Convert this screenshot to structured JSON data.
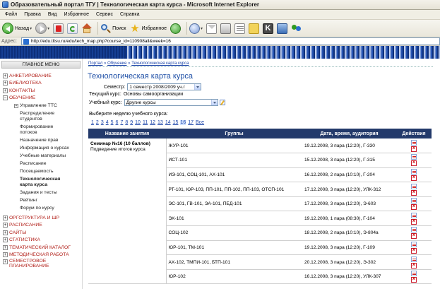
{
  "window": {
    "title": "Образовательный портал ТГУ | Технологическая карта курса - Microsoft Internet Explorer"
  },
  "menubar": {
    "items": [
      "Файл",
      "Правка",
      "Вид",
      "Избранное",
      "Сервис",
      "Справка"
    ]
  },
  "toolbar": {
    "back_label": "Назад",
    "search_label": "Поиск",
    "favorites_label": "Избранное"
  },
  "addressbar": {
    "label": "Адрес:",
    "url": "http://edu.tltsu.ru/edu/tech_map.php?course_id=110908all&week=16"
  },
  "sidebar": {
    "header": "ГЛАВНОЕ МЕНЮ",
    "top_items": [
      {
        "label": "АНКЕТИРОВАНИЕ",
        "expander": "+"
      },
      {
        "label": "БИБЛИОТЕКА",
        "expander": "+"
      },
      {
        "label": "КОНТАКТЫ",
        "expander": "+"
      },
      {
        "label": "ОБУЧЕНИЕ",
        "expander": "−"
      }
    ],
    "sub_items": [
      {
        "label": "Управление ТТС",
        "expander": "+"
      },
      {
        "label": "Распределение студентов"
      },
      {
        "label": "Формирование потоков"
      },
      {
        "label": "Назначение прав"
      },
      {
        "label": "Информация о курсах"
      },
      {
        "label": "Учебные материалы"
      },
      {
        "label": "Расписание"
      },
      {
        "label": "Посещаемость"
      },
      {
        "label": "Технологическая карта курса",
        "active": true
      },
      {
        "label": "Задания и тесты"
      },
      {
        "label": "Рейтинг"
      },
      {
        "label": "Форум по курсу"
      }
    ],
    "bottom_items": [
      {
        "label": "ОРГСТРУКТУРА И ШР",
        "expander": "+"
      },
      {
        "label": "РАСПИСАНИЕ",
        "expander": "+"
      },
      {
        "label": "САЙТЫ",
        "expander": "+"
      },
      {
        "label": "СТАТИСТИКА",
        "expander": "+"
      },
      {
        "label": "ТЕМАТИЧЕСКИЙ КАТАЛОГ",
        "expander": "+"
      },
      {
        "label": "МЕТОДИЧЕСКАЯ РАБОТА",
        "expander": "+"
      },
      {
        "label": "СЕМЕСТРОВОЕ ПЛАНИРОВАНИЕ",
        "expander": "+"
      }
    ]
  },
  "content": {
    "breadcrumb": {
      "portal": "Портал",
      "sep1": "»",
      "learning": "Обучение",
      "sep2": "»",
      "current": "Технологическая карта курса"
    },
    "title": "Технологическая карта курса",
    "semester_label": "Семестр:",
    "semester_value": "1 семестр 2008/2009 уч.г",
    "current_course_label": "Текущий курс:",
    "current_course_value": "Основы самоорганизации",
    "course_label": "Учебный курс:",
    "course_value": "Другие курсы",
    "week_prompt": "Выберите неделю учебного курса:",
    "weeks": [
      "1",
      "2",
      "3",
      "4",
      "5",
      "6",
      "7",
      "8",
      "9",
      "10",
      "11",
      "12",
      "13",
      "14",
      "15",
      "16",
      "17",
      "Все"
    ],
    "current_week": "16",
    "table": {
      "headers": [
        "Название занятия",
        "Группы",
        "Дата, время, аудитория",
        "Действия"
      ],
      "session_title": "Семинар №16 (10 баллов)",
      "session_subtitle": "Подведение итогов курса",
      "rows": [
        {
          "groups": "ЖУР-101",
          "datetime": "19.12.2008, 3 пара (12:20), Г-330"
        },
        {
          "groups": "ИСТ-101",
          "datetime": "15.12.2008, 3 пара (12:20), Г-315"
        },
        {
          "groups": "ИЭ-101, СОЦ-101, АХ-101",
          "datetime": "16.12.2008, 2 пара (10:10), Г-204"
        },
        {
          "groups": "РТ-101, ЮР-103, ПП-101, ПП-102, ПП-103, ОТСП-101",
          "datetime": "17.12.2008, 3 пара (12:20), УЛК-312"
        },
        {
          "groups": "ЭС-101, ГВ-101, ЭА-101, ПЕД-101",
          "datetime": "17.12.2008, 3 пара (12:20), Э-603"
        },
        {
          "groups": "ЭХ-101",
          "datetime": "19.12.2008, 1 пара (08:30), Г-104"
        },
        {
          "groups": "СОЦ-102",
          "datetime": "18.12.2008, 2 пара (10:10), Э-804а"
        },
        {
          "groups": "ЮР-101, ТМ-101",
          "datetime": "19.12.2008, 3 пара (12:20), Г-109"
        },
        {
          "groups": "АХ-102, ТМПИ-101, БТП-101",
          "datetime": "20.12.2008, 3 пара (12:20), Э-302"
        },
        {
          "groups": "ЮР-102",
          "datetime": "16.12.2008, 3 пара (12:20), УЛК-307"
        }
      ]
    }
  }
}
